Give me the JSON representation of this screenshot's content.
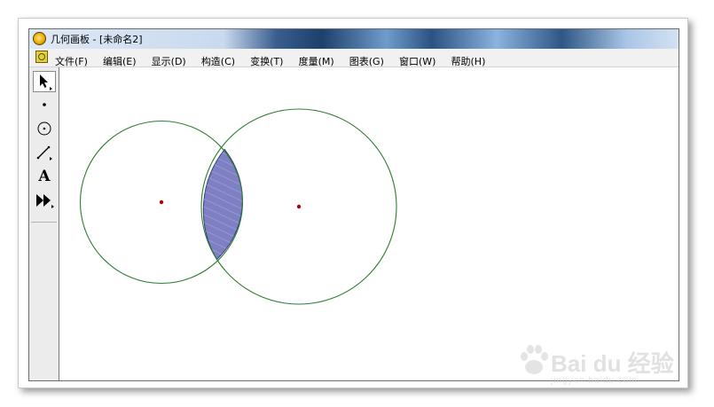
{
  "window": {
    "title": "几何画板 - [未命名2]"
  },
  "menubar": {
    "items": [
      {
        "label": "文件(F)"
      },
      {
        "label": "编辑(E)"
      },
      {
        "label": "显示(D)"
      },
      {
        "label": "构造(C)"
      },
      {
        "label": "变换(T)"
      },
      {
        "label": "度量(M)"
      },
      {
        "label": "图表(G)"
      },
      {
        "label": "窗口(W)"
      },
      {
        "label": "帮助(H)"
      }
    ]
  },
  "toolbox": {
    "tools": [
      {
        "name": "arrow-select-tool",
        "icon": "arrow-icon",
        "selected": true
      },
      {
        "name": "point-tool",
        "icon": "point-icon",
        "selected": false
      },
      {
        "name": "compass-tool",
        "icon": "circle-icon",
        "selected": false
      },
      {
        "name": "straightedge-tool",
        "icon": "segment-icon",
        "selected": false
      },
      {
        "name": "text-tool",
        "icon": "text-icon",
        "label": "A",
        "selected": false
      },
      {
        "name": "custom-tool",
        "icon": "custom-tool-icon",
        "selected": false
      }
    ]
  },
  "canvas": {
    "circle_color": "#2e7d32",
    "center_color": "#b00000",
    "intersection_fill": "#7f7fc4"
  },
  "watermark": {
    "brand": "Bai du 经验",
    "sub": "jingyan.baidu.com"
  }
}
